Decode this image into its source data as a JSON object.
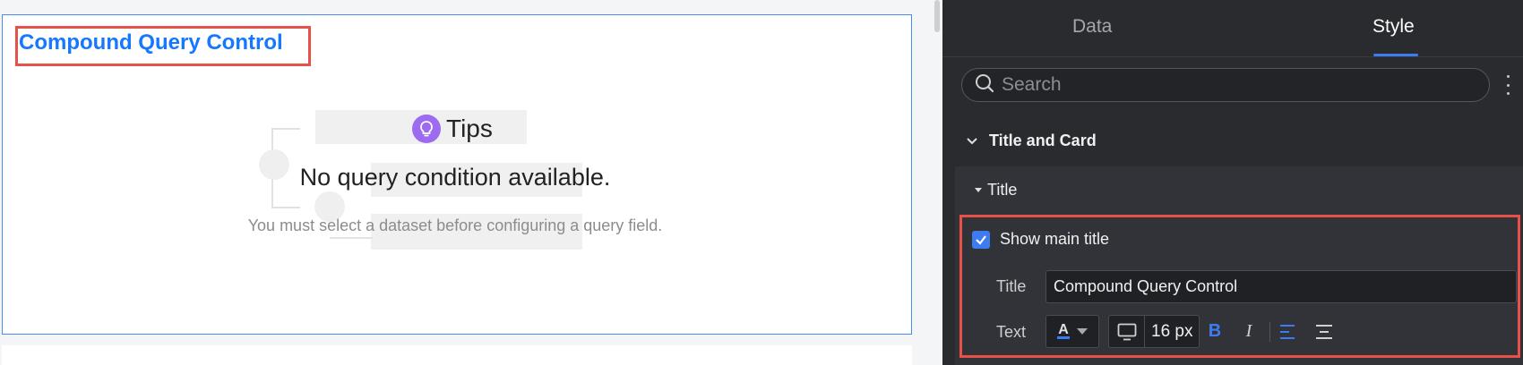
{
  "card": {
    "title": "Compound Query Control",
    "empty_state": {
      "tips_label": "Tips",
      "title": "No query condition available.",
      "subtitle": "You must select a dataset before configuring a query field."
    }
  },
  "panel": {
    "tabs": [
      {
        "label": "Data",
        "active": false
      },
      {
        "label": "Style",
        "active": true
      }
    ],
    "search": {
      "placeholder": "Search",
      "value": ""
    },
    "section": {
      "label": "Title and Card",
      "expanded": true
    },
    "subsection": {
      "label": "Title",
      "expanded": true
    },
    "show_main_title": {
      "label": "Show main title",
      "checked": true
    },
    "title_field": {
      "label": "Title",
      "value": "Compound Query Control"
    },
    "text_field": {
      "label": "Text",
      "color_glyph": "A",
      "font_size": "16 px",
      "bold_glyph": "B",
      "italic_glyph": "I"
    }
  },
  "colors": {
    "accent": "#3d7cf0",
    "title_blue": "#1677ff",
    "highlight_red": "#e8504a",
    "panel_bg": "#2a2b2f",
    "tips_purple": "#9d6bf0"
  },
  "icons": [
    "lightbulb-icon",
    "search-icon",
    "more-vertical-icon",
    "chevron-down-icon",
    "caret-down-icon",
    "check-icon",
    "font-color-icon",
    "monitor-icon",
    "bold-icon",
    "italic-icon",
    "align-left-icon",
    "align-center-icon"
  ]
}
